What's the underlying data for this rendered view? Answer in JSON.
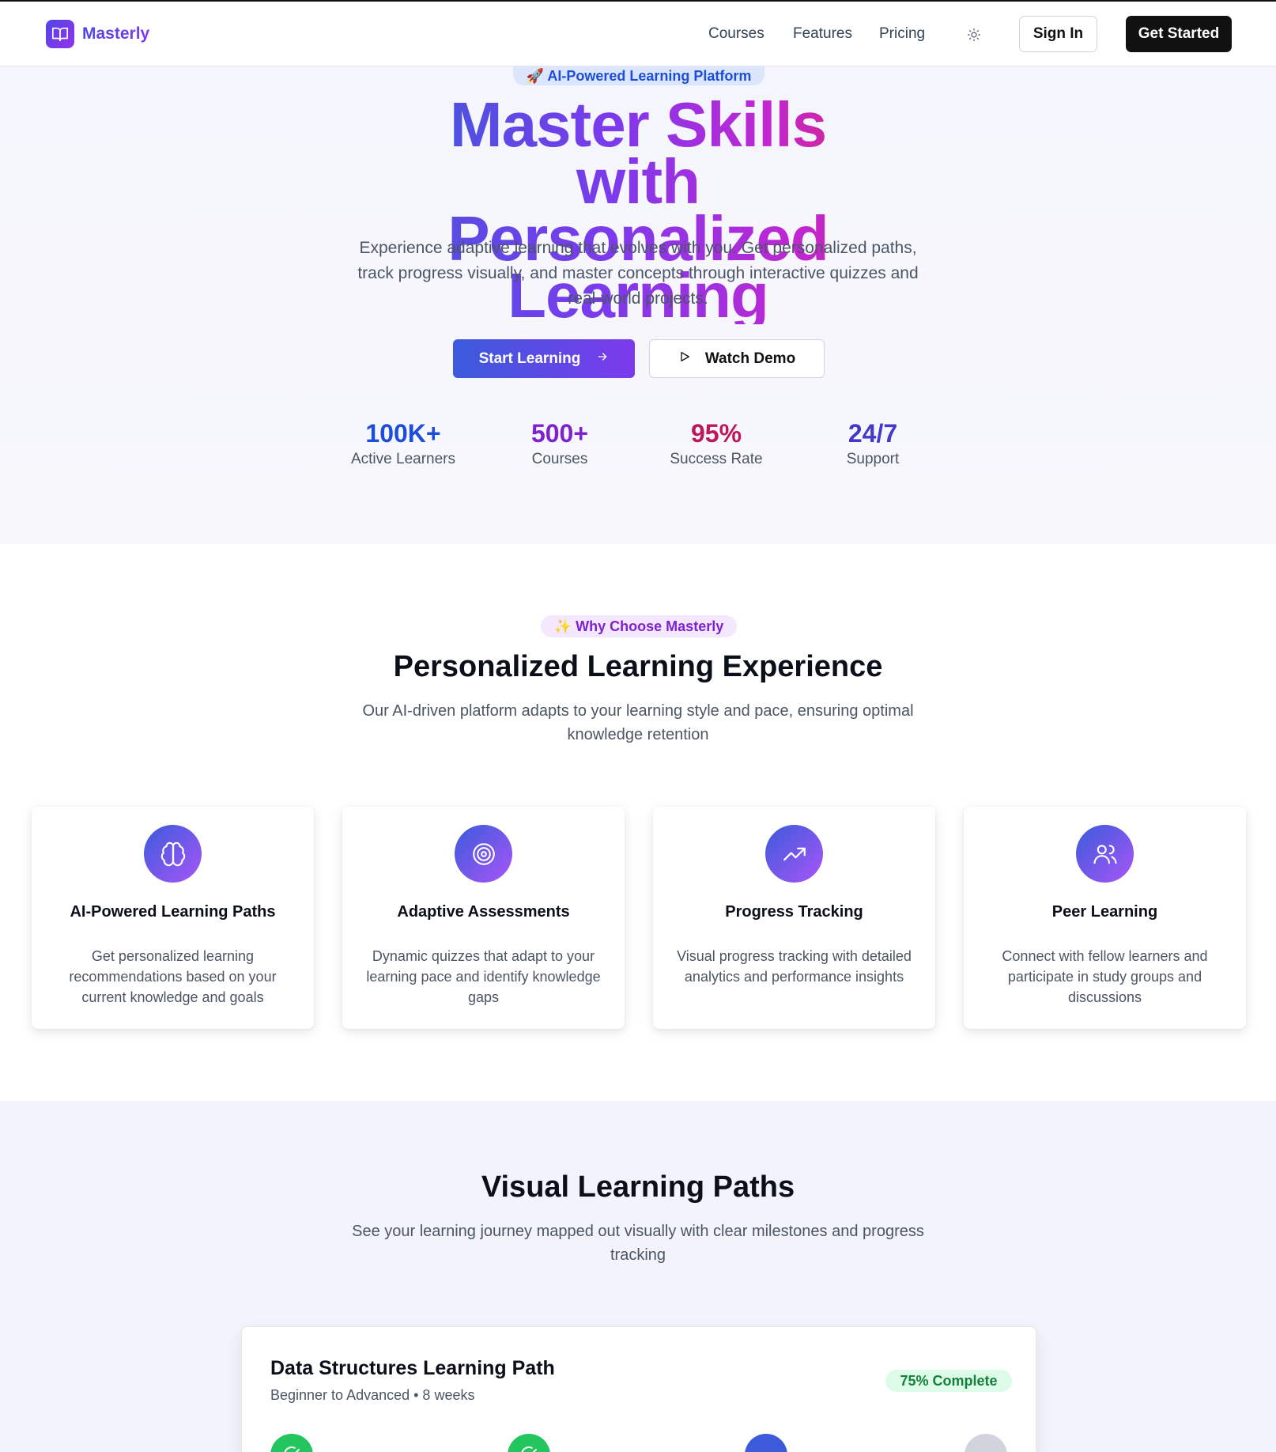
{
  "brand": {
    "name": "Masterly"
  },
  "nav": {
    "links": [
      "Courses",
      "Features",
      "Pricing"
    ],
    "theme_icon": "sun-icon",
    "sign_in": "Sign In",
    "get_started": "Get Started"
  },
  "hero": {
    "badge": "🚀 AI-Powered Learning Platform",
    "title_line1": "Master Skills with",
    "title_line2": "Personalized Learning",
    "subtitle": "Experience adaptive learning that evolves with you. Get personalized paths, track progress visually, and master concepts through interactive quizzes and real-world projects.",
    "primary_cta": "Start Learning",
    "secondary_cta": "Watch Demo",
    "stats": [
      {
        "value": "100K+",
        "label": "Active Learners",
        "color": "#1d4ed8"
      },
      {
        "value": "500+",
        "label": "Courses",
        "color": "#7e22ce"
      },
      {
        "value": "95%",
        "label": "Success Rate",
        "color": "#be185d"
      },
      {
        "value": "24/7",
        "label": "Support",
        "color": "#4338ca"
      }
    ]
  },
  "features": {
    "badge": "✨ Why Choose Masterly",
    "title": "Personalized Learning Experience",
    "subtitle": "Our AI-driven platform adapts to your learning style and pace, ensuring optimal knowledge retention",
    "cards": [
      {
        "icon": "brain-icon",
        "title": "AI-Powered Learning Paths",
        "desc": "Get personalized learning recommendations based on your current knowledge and goals"
      },
      {
        "icon": "target-icon",
        "title": "Adaptive Assessments",
        "desc": "Dynamic quizzes that adapt to your learning pace and identify knowledge gaps"
      },
      {
        "icon": "trending-up-icon",
        "title": "Progress Tracking",
        "desc": "Visual progress tracking with detailed analytics and performance insights"
      },
      {
        "icon": "users-icon",
        "title": "Peer Learning",
        "desc": "Connect with fellow learners and participate in study groups and discussions"
      }
    ]
  },
  "paths": {
    "title": "Visual Learning Paths",
    "subtitle": "See your learning journey mapped out visually with clear milestones and progress tracking",
    "card": {
      "title": "Data Structures Learning Path",
      "meta": "Beginner to Advanced • 8 weeks",
      "badge": "75% Complete",
      "progress": 0.75
    }
  },
  "colors": {
    "accent": "#4f46e5",
    "accent2": "#9333ea",
    "success": "#22c55e"
  }
}
